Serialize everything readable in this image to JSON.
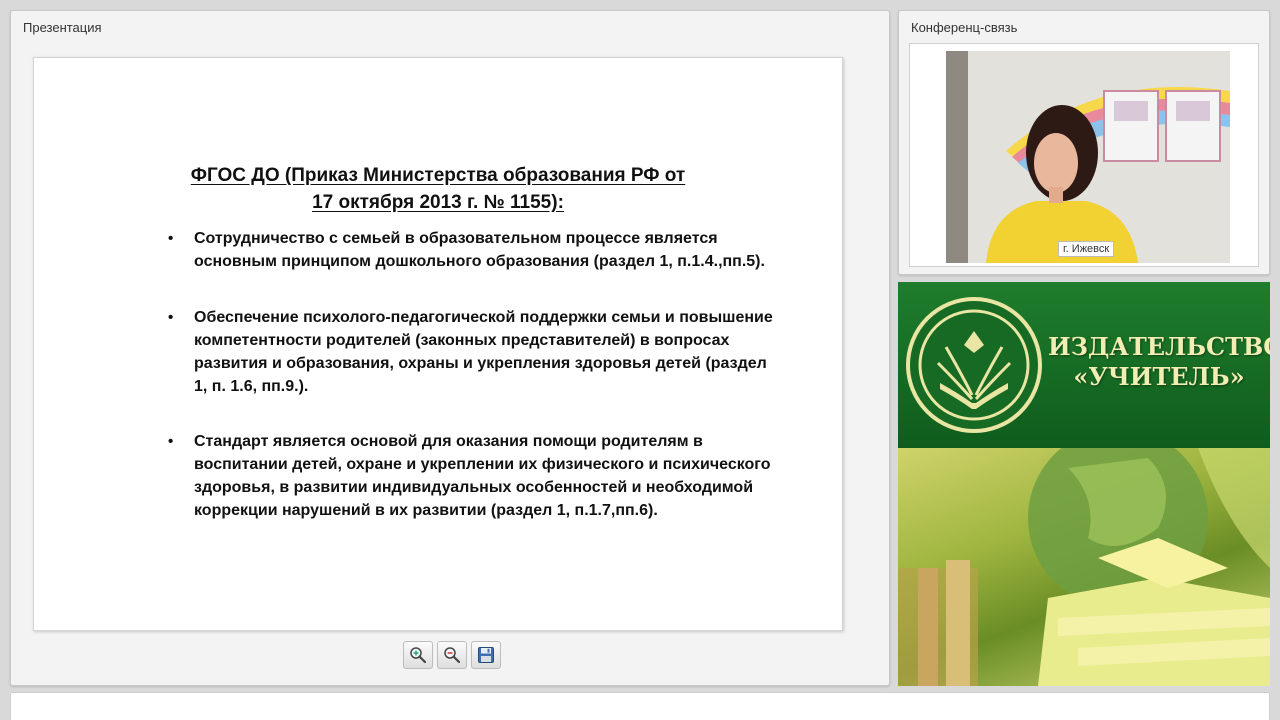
{
  "presentation": {
    "title": "Презентация",
    "slide": {
      "title_lines": [
        "ФГОС ДО (Приказ Министерства образования РФ от",
        "17 октября 2013 г. № 1155):"
      ],
      "bullets": [
        "Сотрудничество с семьей в образовательном процессе является основным принципом дошкольного образования (раздел 1, п.1.4.,пп.5).",
        "Обеспечение психолого-педагогической поддержки семьи и повышение компетентности родителей (законных представителей) в вопросах развития и образования, охраны и укрепления здоровья детей (раздел 1, п. 1.6, пп.9.).",
        "Стандарт является основой для оказания помощи родителям в воспитании детей, охране и укреплении их физического и психического здоровья, в развитии индивидуальных особенностей и необходимой коррекции нарушений в их развитии (раздел 1, п.1.7,пп.6)."
      ]
    },
    "toolbar": {
      "zoom_in_icon": "zoom-in-icon",
      "zoom_out_icon": "zoom-out-icon",
      "save_icon": "floppy-disk-icon"
    }
  },
  "conference": {
    "title": "Конференц-связь",
    "video_label": "г. Ижевск"
  },
  "ad": {
    "line1": "ИЗДАТЕЛЬСТВО",
    "line2": "«УЧИТЕЛЬ»",
    "colors": {
      "green": "#176a24",
      "cream": "#f1edb3"
    }
  }
}
